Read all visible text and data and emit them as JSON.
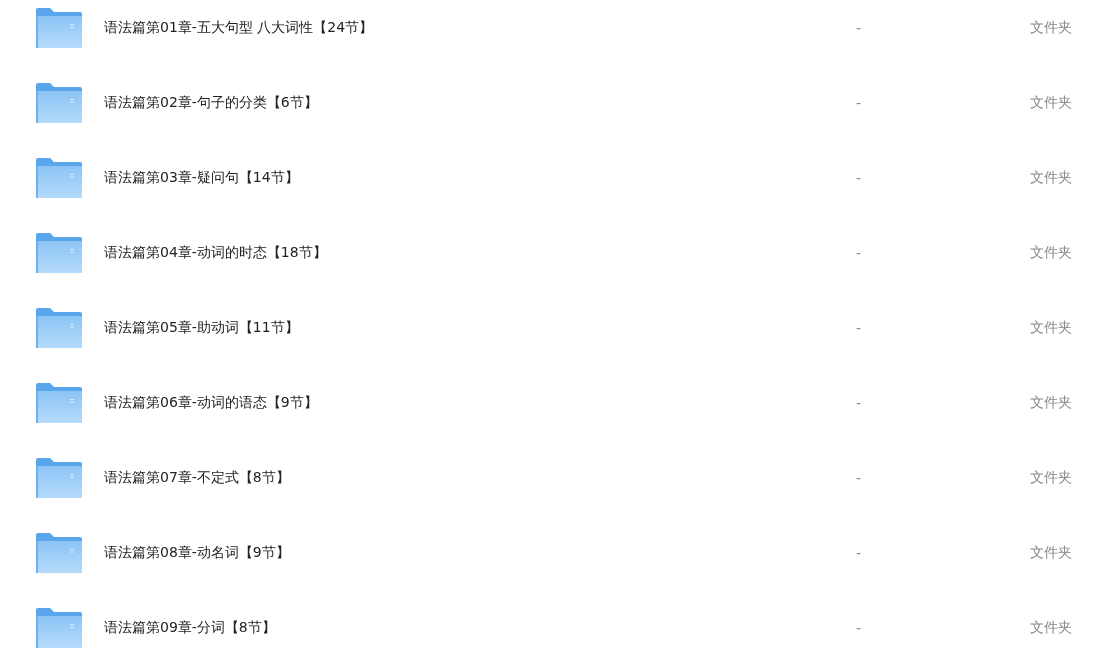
{
  "files": [
    {
      "name": "语法篇第01章-五大句型 八大词性【24节】",
      "size": "-",
      "type": "文件夹"
    },
    {
      "name": "语法篇第02章-句子的分类【6节】",
      "size": "-",
      "type": "文件夹"
    },
    {
      "name": "语法篇第03章-疑问句【14节】",
      "size": "-",
      "type": "文件夹"
    },
    {
      "name": "语法篇第04章-动词的时态【18节】",
      "size": "-",
      "type": "文件夹"
    },
    {
      "name": "语法篇第05章-助动词【11节】",
      "size": "-",
      "type": "文件夹"
    },
    {
      "name": "语法篇第06章-动词的语态【9节】",
      "size": "-",
      "type": "文件夹"
    },
    {
      "name": "语法篇第07章-不定式【8节】",
      "size": "-",
      "type": "文件夹"
    },
    {
      "name": "语法篇第08章-动名词【9节】",
      "size": "-",
      "type": "文件夹"
    },
    {
      "name": "语法篇第09章-分词【8节】",
      "size": "-",
      "type": "文件夹"
    }
  ]
}
